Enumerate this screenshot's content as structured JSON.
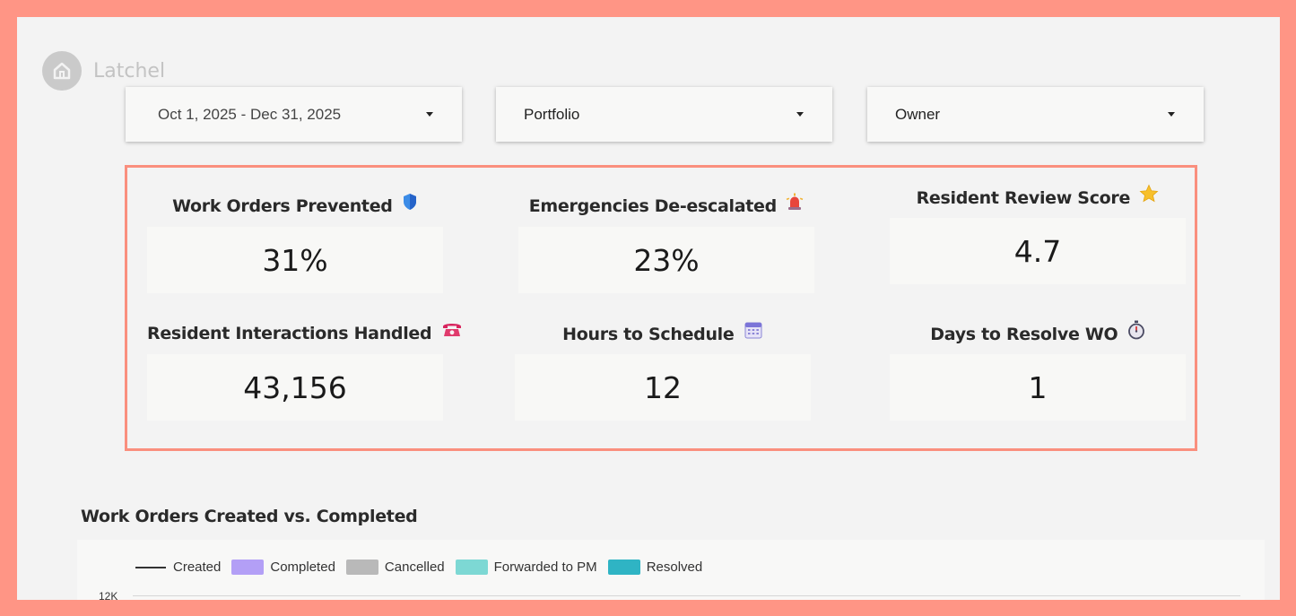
{
  "brand": {
    "name": "Latchel"
  },
  "filters": {
    "date_range": "Oct 1, 2025 - Dec 31, 2025",
    "portfolio": "Portfolio",
    "owner": "Owner"
  },
  "kpis": [
    {
      "title": "Work Orders Prevented",
      "emoji": "🛡️",
      "value": "31%"
    },
    {
      "title": "Emergencies De-escalated",
      "emoji": "🚨",
      "value": "23%"
    },
    {
      "title": "Resident Review Score",
      "emoji": "⭐",
      "value": "4.7"
    },
    {
      "title": "Resident Interactions Handled",
      "emoji": "☎️",
      "value": "43,156"
    },
    {
      "title": "Hours to Schedule",
      "emoji": "📅",
      "value": "12"
    },
    {
      "title": "Days to Resolve WO",
      "emoji": "⏱️",
      "value": "1"
    }
  ],
  "chart": {
    "title": "Work Orders Created vs. Completed",
    "y_tick_top": "12K"
  },
  "chart_data": {
    "type": "bar",
    "title": "Work Orders Created vs. Completed",
    "series": [
      {
        "name": "Created",
        "mark": "line",
        "color": "#333333"
      },
      {
        "name": "Completed",
        "mark": "bar",
        "color": "#b39ff6"
      },
      {
        "name": "Cancelled",
        "mark": "bar",
        "color": "#b9b9b9"
      },
      {
        "name": "Forwarded to PM",
        "mark": "bar",
        "color": "#7dd8d4"
      },
      {
        "name": "Resolved",
        "mark": "bar",
        "color": "#2fb4c4"
      }
    ],
    "y_ticks_visible": [
      "12K"
    ],
    "legend_position": "top-left",
    "grid": true
  },
  "colors": {
    "frame_border": "#fa8f7e",
    "background_border": "#ff9585"
  }
}
